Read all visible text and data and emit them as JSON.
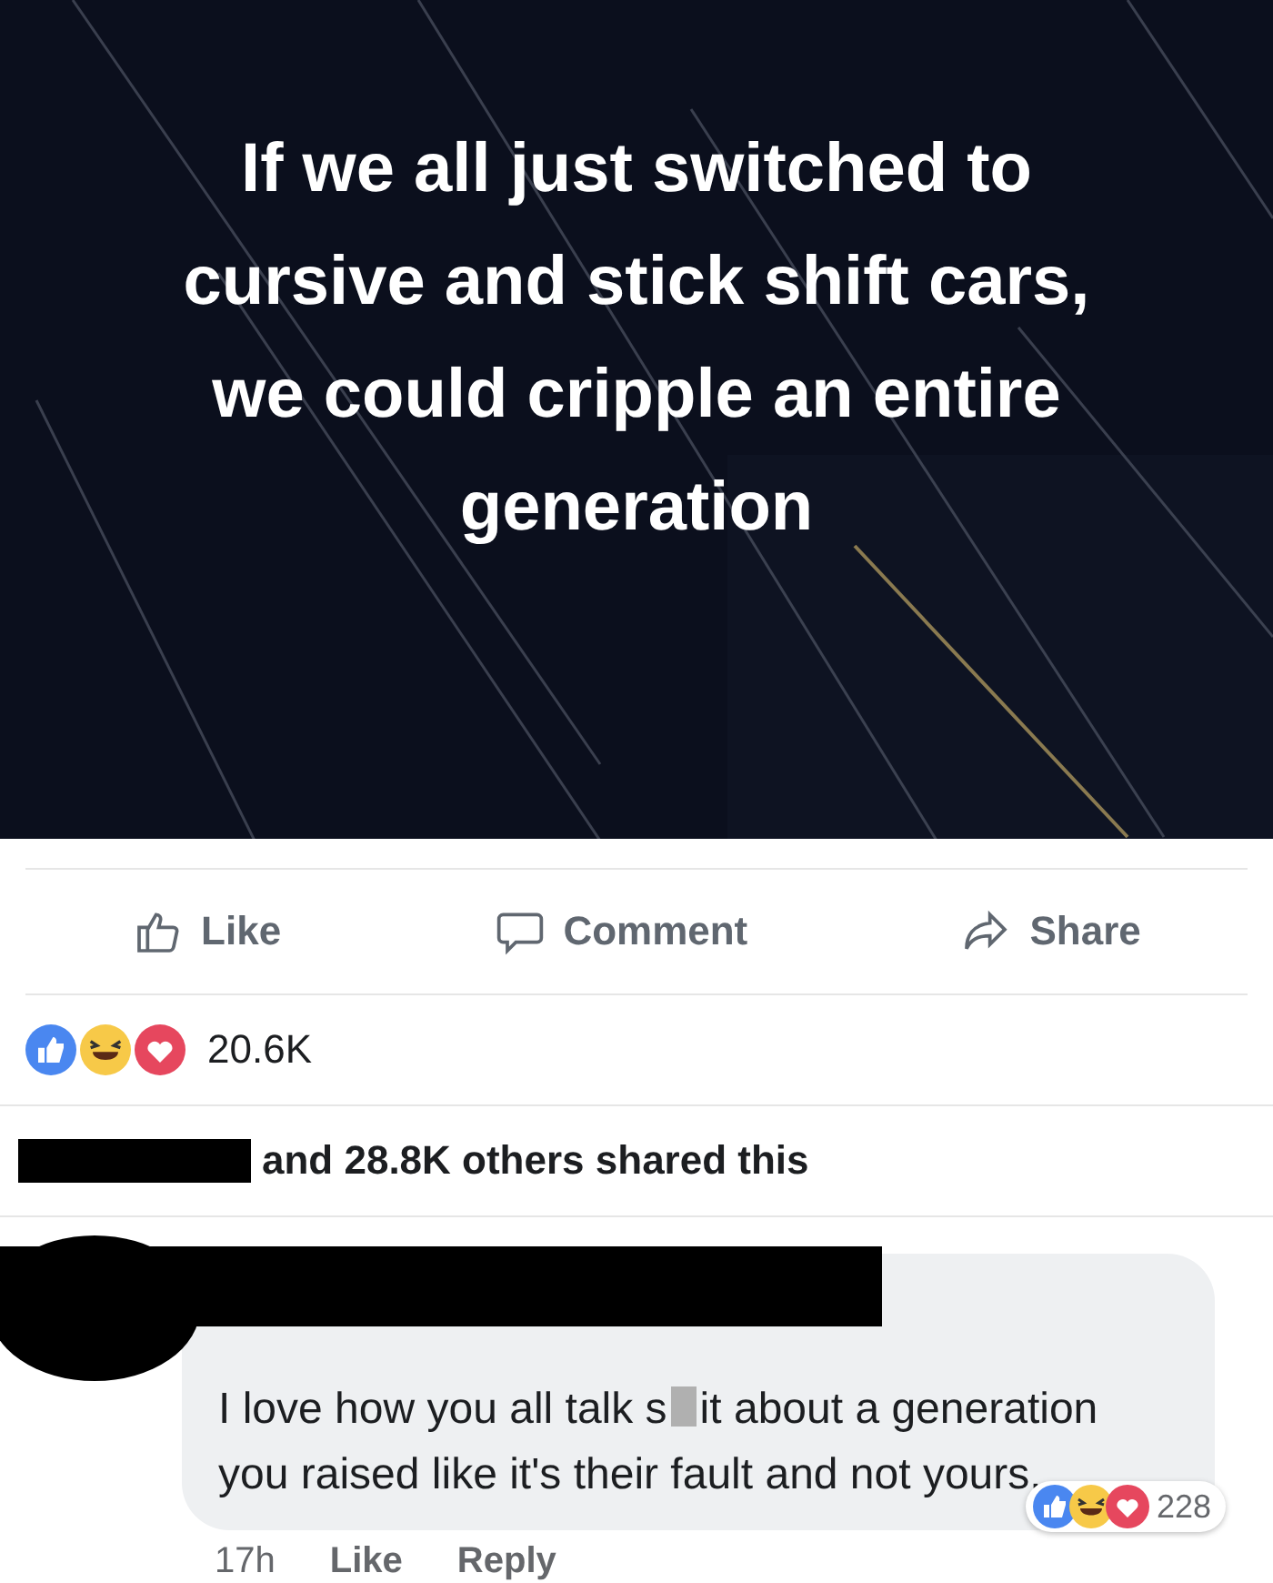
{
  "post_image": {
    "caption": "If we all just switched to cursive and stick shift cars, we could cripple an entire generation"
  },
  "actions": [
    {
      "kind": "like",
      "label": "Like"
    },
    {
      "kind": "comment",
      "label": "Comment"
    },
    {
      "kind": "share",
      "label": "Share"
    }
  ],
  "reactions": {
    "count": "20.6K"
  },
  "shares": {
    "text": "and 28.8K others shared this"
  },
  "comment": {
    "text_before": "I love how you all talk s",
    "text_after": "it about a generation you raised like it's their fault and not yours.",
    "time": "17h",
    "like": "Like",
    "reply": "Reply",
    "reactions_count": "228"
  }
}
